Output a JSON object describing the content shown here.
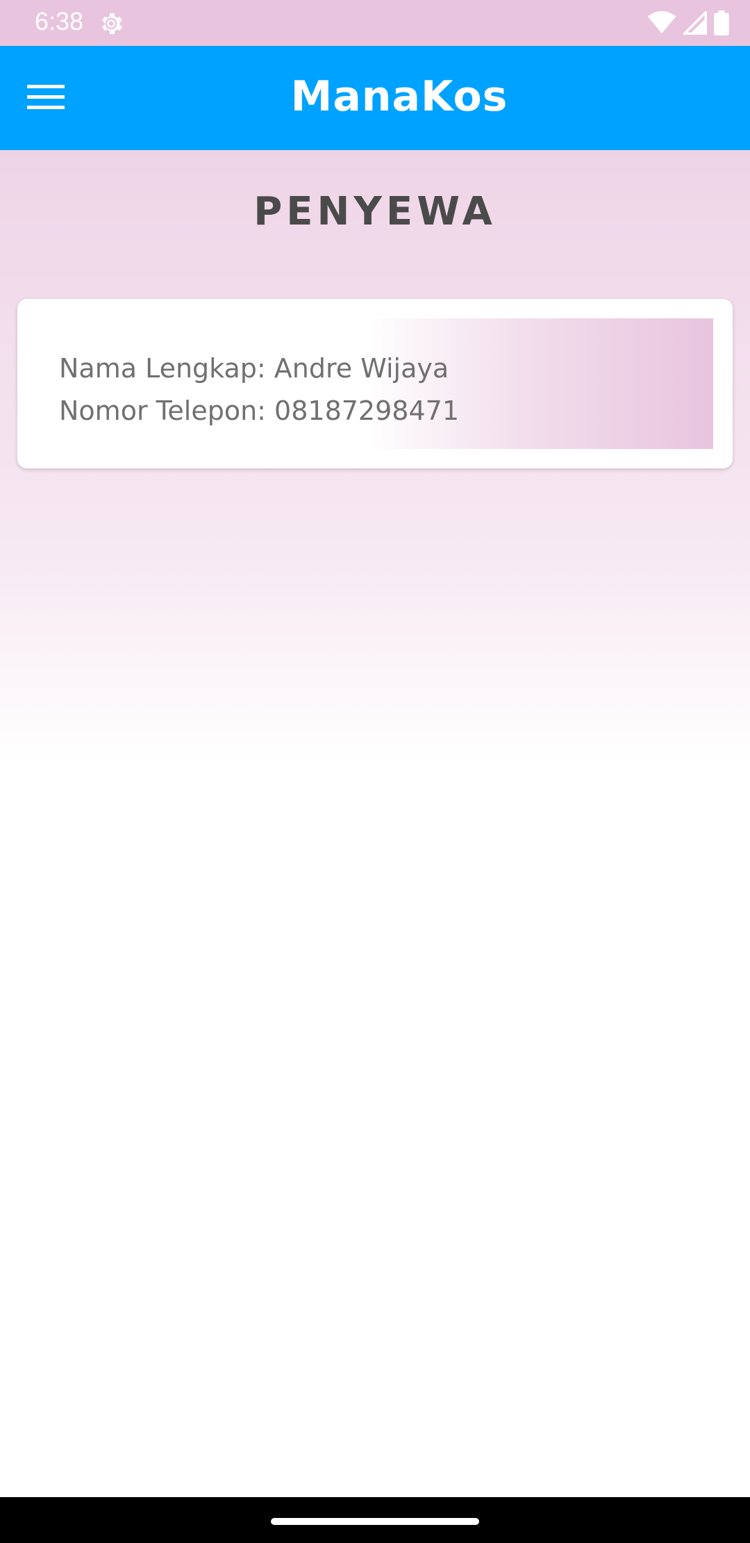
{
  "status_bar": {
    "time": "6:38",
    "icons": [
      "settings-gear-icon",
      "wifi-icon",
      "signal-icon",
      "battery-icon"
    ]
  },
  "app_bar": {
    "title": "ManaKos",
    "menu_icon": "hamburger-menu-icon",
    "background_color": "#00a2ff"
  },
  "page": {
    "heading": "PENYEWA"
  },
  "tenants": [
    {
      "name_line": "Nama Lengkap: Andre Wijaya",
      "phone_line": "Nomor Telepon: 08187298471"
    }
  ],
  "colors": {
    "accent_pink": "#e8c4de",
    "heading_text": "#4a4a4a",
    "card_text": "#707070"
  }
}
